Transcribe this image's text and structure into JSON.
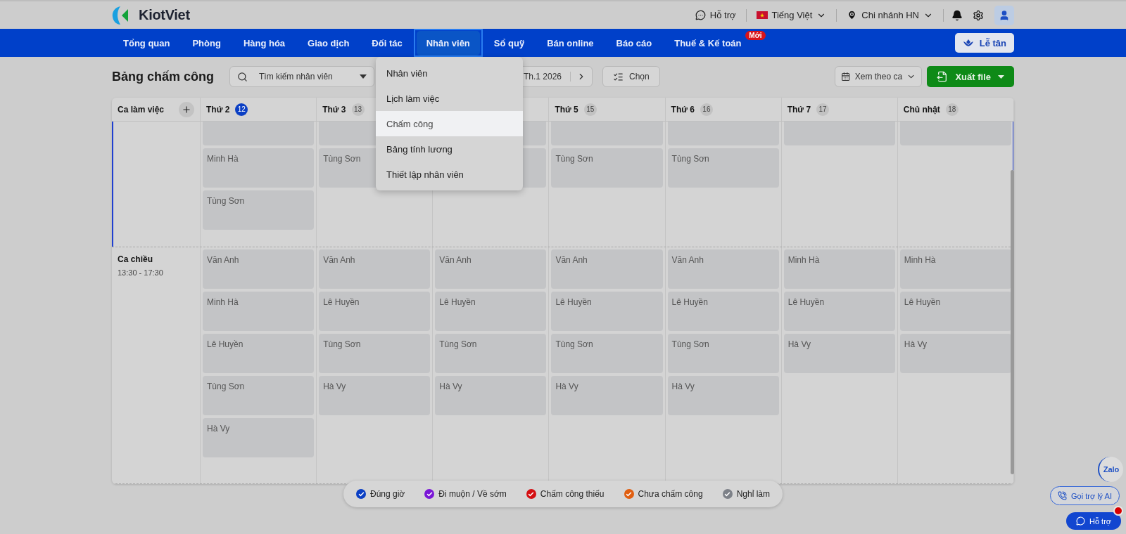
{
  "brand": {
    "name": "KiotViet"
  },
  "top_bar": {
    "support": "Hỗ trợ",
    "language": "Tiếng Việt",
    "branch": "Chi nhánh HN"
  },
  "nav": {
    "items": [
      {
        "label": "Tổng quan",
        "selected": false
      },
      {
        "label": "Phòng",
        "selected": false
      },
      {
        "label": "Hàng hóa",
        "selected": false
      },
      {
        "label": "Giao dịch",
        "selected": false
      },
      {
        "label": "Đối tác",
        "selected": false
      },
      {
        "label": "Nhân viên",
        "selected": true
      },
      {
        "label": "Sổ quỹ",
        "selected": false
      },
      {
        "label": "Bán online",
        "selected": false
      },
      {
        "label": "Báo cáo",
        "selected": false
      },
      {
        "label": "Thuế & Kế toán",
        "selected": false,
        "badge": "Mới"
      }
    ],
    "reception_button": "Lễ tân"
  },
  "dropdown": {
    "items": [
      {
        "label": "Nhân viên",
        "selected": false
      },
      {
        "label": "Lịch làm việc",
        "selected": false
      },
      {
        "label": "Chấm công",
        "selected": true
      },
      {
        "label": "Bảng tính lương",
        "selected": false
      },
      {
        "label": "Thiết lập nhân viên",
        "selected": false
      }
    ]
  },
  "toolbar": {
    "title": "Bảng chấm công",
    "search_placeholder": "Tìm kiếm nhân viên",
    "period": "Th.1 2026",
    "select_button": "Chọn",
    "view_select": "Xem theo ca",
    "export_button": "Xuất file"
  },
  "timesheet": {
    "corner": "Ca làm việc",
    "days": [
      {
        "kind": "day",
        "label": "Thứ 2",
        "date": "12",
        "today": true
      },
      {
        "kind": "day",
        "label": "Thứ 3",
        "date": "13",
        "today": false
      },
      {
        "kind": "covered"
      },
      {
        "kind": "day",
        "label": "Thứ 5",
        "date": "15",
        "today": false
      },
      {
        "kind": "day",
        "label": "Thứ 6",
        "date": "16",
        "today": false
      },
      {
        "kind": "day",
        "label": "Thứ 7",
        "date": "17",
        "today": false
      },
      {
        "kind": "day",
        "label": "Chủ nhật",
        "date": "18",
        "today": false
      }
    ],
    "shifts": [
      {
        "selected": true,
        "cells": [
          [
            {},
            {
              "name": "Minh Hà"
            },
            {
              "name": "Tùng Sơn"
            }
          ],
          [
            {},
            {
              "name": "Tùng Sơn"
            }
          ],
          [
            {},
            {}
          ],
          [
            {},
            {
              "name": "Tùng Sơn"
            }
          ],
          [
            {},
            {
              "name": "Tùng Sơn"
            }
          ],
          [
            {}
          ],
          [
            {}
          ]
        ]
      },
      {
        "selected": false,
        "name": "Ca chiều",
        "time": "13:30 - 17:30",
        "cells": [
          [
            {
              "name": "Văn Anh"
            },
            {
              "name": "Minh Hà"
            },
            {
              "name": "Lê Huyền"
            },
            {
              "name": "Tùng Sơn"
            },
            {
              "name": "Hà Vy"
            }
          ],
          [
            {
              "name": "Văn Anh"
            },
            {
              "name": "Lê Huyền"
            },
            {
              "name": "Tùng Sơn"
            },
            {
              "name": "Hà Vy"
            }
          ],
          [
            {
              "name": "Văn Anh"
            },
            {
              "name": "Lê Huyền"
            },
            {
              "name": "Tùng Sơn"
            },
            {
              "name": "Hà Vy"
            }
          ],
          [
            {
              "name": "Văn Anh"
            },
            {
              "name": "Lê Huyền"
            },
            {
              "name": "Tùng Sơn"
            },
            {
              "name": "Hà Vy"
            }
          ],
          [
            {
              "name": "Văn Anh"
            },
            {
              "name": "Lê Huyền"
            },
            {
              "name": "Tùng Sơn"
            },
            {
              "name": "Hà Vy"
            }
          ],
          [
            {
              "name": "Minh Hà"
            },
            {
              "name": "Lê Huyền"
            },
            {
              "name": "Hà Vy"
            }
          ],
          [
            {
              "name": "Minh Hà"
            },
            {
              "name": "Lê Huyền"
            },
            {
              "name": "Hà Vy"
            }
          ]
        ]
      }
    ]
  },
  "legend": [
    {
      "label": "Đúng giờ",
      "color": "#0b3fc4"
    },
    {
      "label": "Đi muộn / Về sớm",
      "color": "#7a16d6"
    },
    {
      "label": "Chấm công thiếu",
      "color": "#d40f12"
    },
    {
      "label": "Chưa chấm công",
      "color": "#e05e10"
    },
    {
      "label": "Nghỉ làm",
      "color": "#7d8188"
    }
  ],
  "floating": {
    "zalo": "Zalo",
    "ai_button": "Gọi trợ lý AI",
    "support_button": "Hỗ trợ",
    "support_alert": true
  }
}
